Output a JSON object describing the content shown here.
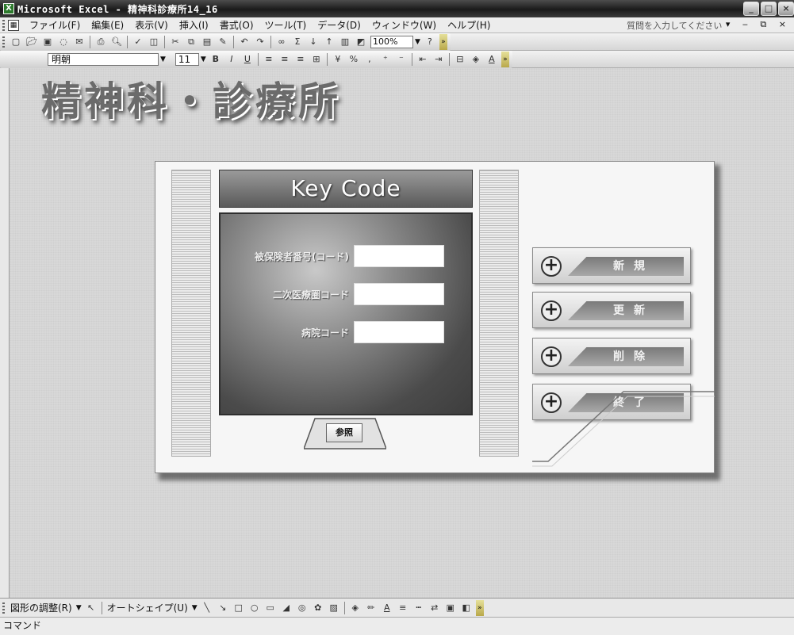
{
  "window": {
    "title": "Microsoft Excel - 精神科診療所14_16",
    "app_icon": "X",
    "controls": [
      "_",
      "□",
      "×"
    ]
  },
  "menubar": {
    "items": [
      "ファイル(F)",
      "編集(E)",
      "表示(V)",
      "挿入(I)",
      "書式(O)",
      "ツール(T)",
      "データ(D)",
      "ウィンドウ(W)",
      "ヘルプ(H)"
    ],
    "help_placeholder": "質問を入力してください",
    "right_controls": "▾ ‒ ⧉ ×"
  },
  "standard_toolbar": {
    "zoom": "100%",
    "icons": [
      "new-icon",
      "open-icon",
      "save-icon",
      "permission-icon",
      "email-icon",
      "print-icon",
      "print-preview-icon",
      "spelling-icon",
      "research-icon",
      "cut-icon",
      "copy-icon",
      "paste-icon",
      "format-painter-icon",
      "undo-icon",
      "redo-icon",
      "hyperlink-icon",
      "autosum-icon",
      "sort-ascending-icon",
      "sort-descending-icon",
      "chart-wizard-icon",
      "drawing-icon",
      "help-icon"
    ]
  },
  "formatting_toolbar": {
    "font": "明朝",
    "size": "11",
    "bold": "B",
    "italic": "I",
    "underline": "U"
  },
  "sheet": {
    "title": "精神科・診療所",
    "panel": {
      "header": "Key Code",
      "fields": [
        {
          "label": "被保険者番号(コード)",
          "value": ""
        },
        {
          "label": "二次医療圏コード",
          "value": ""
        },
        {
          "label": "病院コード",
          "value": ""
        }
      ],
      "ref_button": "参照",
      "side_buttons": [
        {
          "label": "新規"
        },
        {
          "label": "更新"
        },
        {
          "label": "削除"
        },
        {
          "label": "終了"
        }
      ]
    }
  },
  "drawing_toolbar": {
    "draw_menu": "図形の調整(R)",
    "autoshape_menu": "オートシェイプ(U)"
  },
  "statusbar": {
    "text": "コマンド"
  }
}
